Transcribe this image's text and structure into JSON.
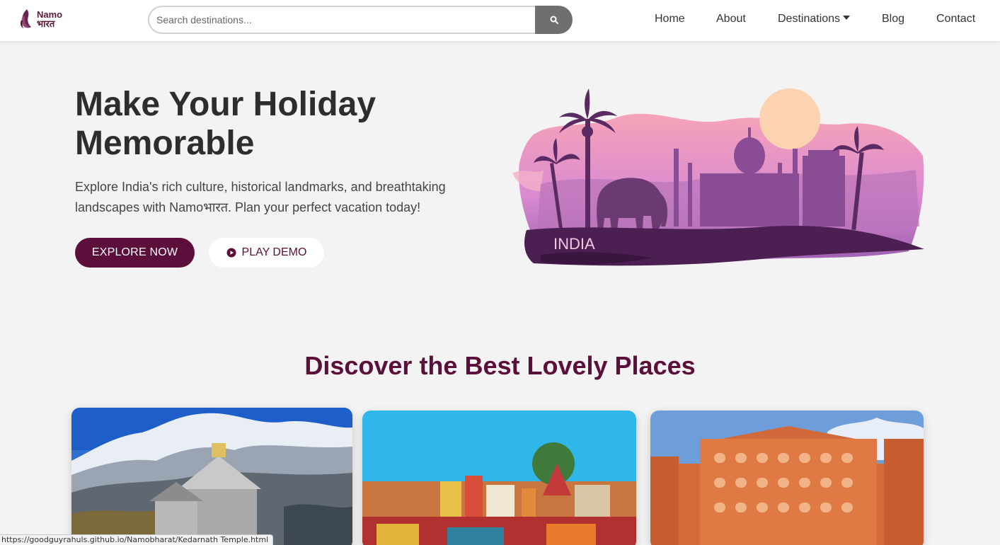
{
  "brand": {
    "line1": "Namo",
    "line2": "भारत"
  },
  "search": {
    "placeholder": "Search destinations..."
  },
  "nav": {
    "home": "Home",
    "about": "About",
    "destinations": "Destinations",
    "blog": "Blog",
    "contact": "Contact"
  },
  "hero": {
    "title": "Make Your Holiday Memorable",
    "description": "Explore India's rich culture, historical landmarks, and breathtaking landscapes with Namoभारत. Plan your perfect vacation today!",
    "explore_label": "EXPLORE NOW",
    "demo_label": "PLAY DEMO",
    "art_label": "INDIA"
  },
  "section": {
    "title": "Discover the Best Lovely Places"
  },
  "status_bar": {
    "url": "https://goodguyrahuls.github.io/Namobharat/Kedarnath Temple.html"
  },
  "colors": {
    "brand": "#5b0f3a",
    "search_button": "#6f6f6f",
    "background": "#f3f3f3"
  },
  "icons": [
    "logo-mark-icon",
    "search-icon",
    "caret-down-icon",
    "play-icon"
  ]
}
